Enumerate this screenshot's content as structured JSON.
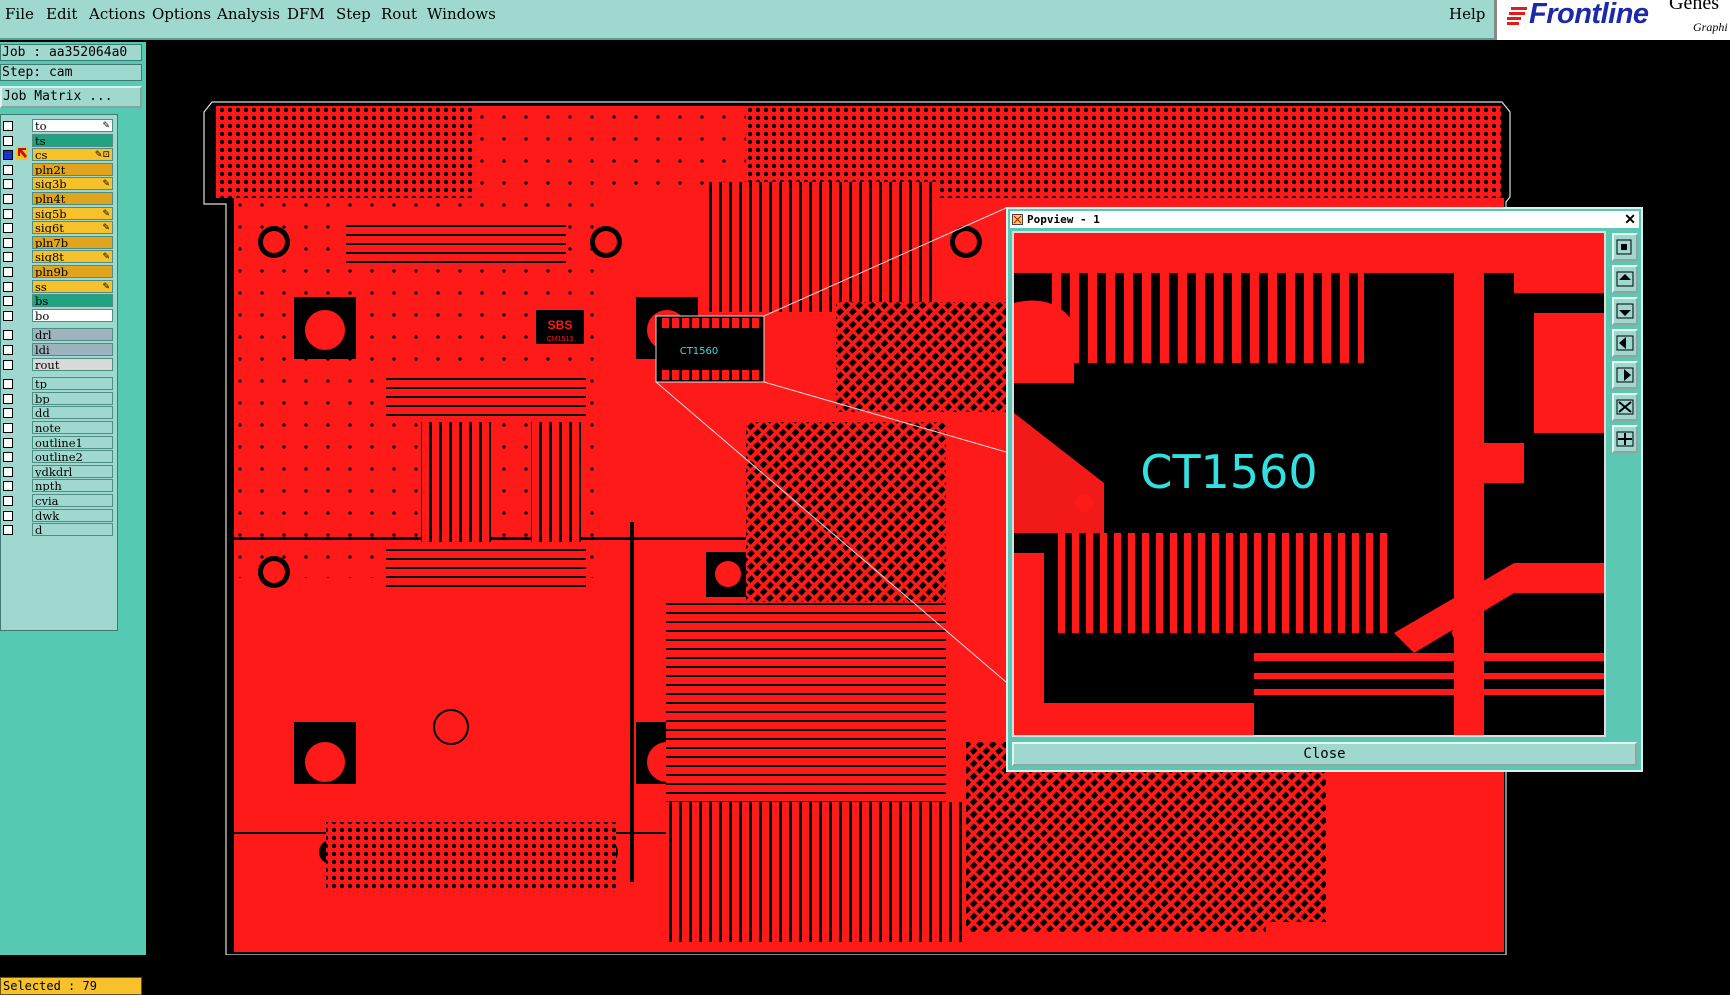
{
  "menu": {
    "items": [
      "File",
      "Edit",
      "Actions",
      "Options",
      "Analysis",
      "DFM",
      "Step",
      "Rout",
      "Windows"
    ],
    "help": "Help"
  },
  "logo": {
    "brand": "Frontline",
    "product": "Genes",
    "tagline": "Graphi"
  },
  "job": {
    "label": "Job : aa352064a0",
    "step": "Step: cam",
    "matrix_button": "Job Matrix ..."
  },
  "layers": [
    {
      "name": "to",
      "color": "#ffffff",
      "checked": false,
      "flag": "✎"
    },
    {
      "name": "ts",
      "color": "#1fa381",
      "checked": false,
      "flag": ""
    },
    {
      "name": "cs",
      "color": "#f6c12a",
      "checked": true,
      "flag": "✎⊡",
      "active": true
    },
    {
      "name": "pln2t",
      "color": "#e0a51d",
      "checked": false,
      "flag": ""
    },
    {
      "name": "sig3b",
      "color": "#f6c12a",
      "checked": false,
      "flag": "✎"
    },
    {
      "name": "pln4t",
      "color": "#e0a51d",
      "checked": false,
      "flag": ""
    },
    {
      "name": "sig5b",
      "color": "#f6c12a",
      "checked": false,
      "flag": "✎"
    },
    {
      "name": "sig6t",
      "color": "#f6c12a",
      "checked": false,
      "flag": "✎"
    },
    {
      "name": "pln7b",
      "color": "#e0a51d",
      "checked": false,
      "flag": ""
    },
    {
      "name": "sig8t",
      "color": "#f6c12a",
      "checked": false,
      "flag": "✎"
    },
    {
      "name": "pln9b",
      "color": "#e0a51d",
      "checked": false,
      "flag": ""
    },
    {
      "name": "ss",
      "color": "#f6c12a",
      "checked": false,
      "flag": "✎"
    },
    {
      "name": "bs",
      "color": "#1fa381",
      "checked": false,
      "flag": ""
    },
    {
      "name": "bo",
      "color": "#ffffff",
      "checked": false,
      "flag": ""
    },
    {
      "name": "drl",
      "color": "#9db3bd",
      "checked": false,
      "flag": "",
      "gap": true
    },
    {
      "name": "ldi",
      "color": "#9db3bd",
      "checked": false,
      "flag": ""
    },
    {
      "name": "rout",
      "color": "#d9d9d9",
      "checked": false,
      "flag": ""
    },
    {
      "name": "tp",
      "color": "#9fd8cf",
      "checked": false,
      "flag": "",
      "gap": true
    },
    {
      "name": "bp",
      "color": "#9fd8cf",
      "checked": false,
      "flag": ""
    },
    {
      "name": "dd",
      "color": "#9fd8cf",
      "checked": false,
      "flag": ""
    },
    {
      "name": "note",
      "color": "#9fd8cf",
      "checked": false,
      "flag": ""
    },
    {
      "name": "outline1",
      "color": "#9fd8cf",
      "checked": false,
      "flag": ""
    },
    {
      "name": "outline2",
      "color": "#9fd8cf",
      "checked": false,
      "flag": ""
    },
    {
      "name": "ydkdrl",
      "color": "#9fd8cf",
      "checked": false,
      "flag": ""
    },
    {
      "name": "npth",
      "color": "#9fd8cf",
      "checked": false,
      "flag": ""
    },
    {
      "name": "cvia",
      "color": "#9fd8cf",
      "checked": false,
      "flag": ""
    },
    {
      "name": "dwk",
      "color": "#9fd8cf",
      "checked": false,
      "flag": ""
    },
    {
      "name": "d",
      "color": "#9fd8cf",
      "checked": false,
      "flag": ""
    }
  ],
  "status": {
    "selected": "Selected : 79"
  },
  "board": {
    "chip_label": "CT1560",
    "silk_logo": "SBS",
    "silk_part": "CM1513"
  },
  "popview": {
    "title": "Popview - 1",
    "close_x": "✕",
    "close_label": "Close",
    "zoom_label": "CT1560",
    "tools": [
      "zoom-fit-icon",
      "pan-up-icon",
      "pan-down-icon",
      "pan-left-icon",
      "pan-right-icon",
      "zoom-in-icon",
      "zoom-out-icon"
    ]
  },
  "colors": {
    "copper": "#ff1a1a",
    "panel": "#56c9b2",
    "light_panel": "#9fd8cf",
    "silk": "#33e0e0",
    "brand": "#1d2aa8"
  }
}
